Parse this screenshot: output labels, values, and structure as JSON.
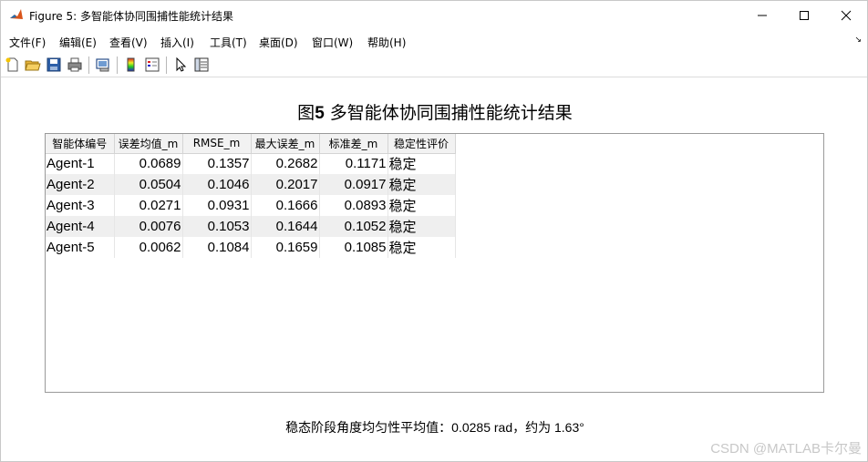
{
  "window": {
    "title": "Figure 5: 多智能体协同围捕性能统计结果",
    "icon": "matlab-icon"
  },
  "menubar": {
    "items": [
      "文件(F)",
      "编辑(E)",
      "查看(V)",
      "插入(I)",
      "工具(T)",
      "桌面(D)",
      "窗口(W)",
      "帮助(H)"
    ]
  },
  "toolbar": {
    "icons": [
      "new-figure-icon",
      "open-file-icon",
      "save-icon",
      "print-icon",
      "link-plot-icon",
      "insert-colorbar-icon",
      "insert-legend-icon",
      "edit-plot-icon",
      "property-inspector-icon"
    ]
  },
  "figure": {
    "title_prefix": "图",
    "title_number": "5",
    "title_rest": " 多智能体协同围捕性能统计结果",
    "footnote": "稳态阶段角度均匀性平均值：0.0285 rad，约为 1.63°"
  },
  "table": {
    "columns": [
      "智能体编号",
      "误差均值_m",
      "RMSE_m",
      "最大误差_m",
      "标准差_m",
      "稳定性评价"
    ],
    "rows": [
      [
        "Agent-1",
        "0.0689",
        "0.1357",
        "0.2682",
        "0.1171",
        "稳定"
      ],
      [
        "Agent-2",
        "0.0504",
        "0.1046",
        "0.2017",
        "0.0917",
        "稳定"
      ],
      [
        "Agent-3",
        "0.0271",
        "0.0931",
        "0.1666",
        "0.0893",
        "稳定"
      ],
      [
        "Agent-4",
        "0.0076",
        "0.1053",
        "0.1644",
        "0.1052",
        "稳定"
      ],
      [
        "Agent-5",
        "0.0062",
        "0.1084",
        "0.1659",
        "0.1085",
        "稳定"
      ]
    ]
  },
  "watermark": "CSDN @MATLAB卡尔曼"
}
